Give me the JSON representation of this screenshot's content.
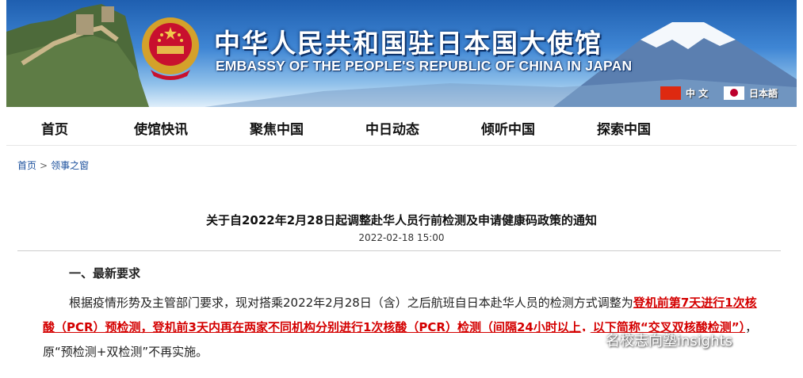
{
  "banner": {
    "title_zh": "中华人民共和国驻日本国大使馆",
    "title_en": "EMBASSY OF THE PEOPLE'S REPUBLIC OF CHINA IN JAPAN",
    "lang_zh": "中 文",
    "lang_ja": "日本語"
  },
  "nav": [
    "首页",
    "使馆快讯",
    "聚焦中国",
    "中日动态",
    "倾听中国",
    "探索中国"
  ],
  "breadcrumb": {
    "home": "首页",
    "sep": ">",
    "section": "领事之窗"
  },
  "article": {
    "title": "关于自2022年2月28日起调整赴华人员行前检测及申请健康码政策的通知",
    "date": "2022-02-18 15:00",
    "section_heading": "一、最新要求",
    "para_lead": "根据疫情形势及主管部门要求，现对搭乘2022年2月28日（含）之后航班自日本赴华人员的检测方式调整为",
    "para_highlight": "登机前第7天进行1次核酸（PCR）预检测，登机前3天内再在两家不同机构分别进行1次核酸（PCR）检测（间隔24小时以上，以下简称“交叉双核酸检测”）",
    "para_tail": "，原“预检测+双检测”不再实施。"
  },
  "watermark": "名校志向塾insights",
  "colors": {
    "link": "#1a4f9c",
    "highlight": "#d40000"
  }
}
